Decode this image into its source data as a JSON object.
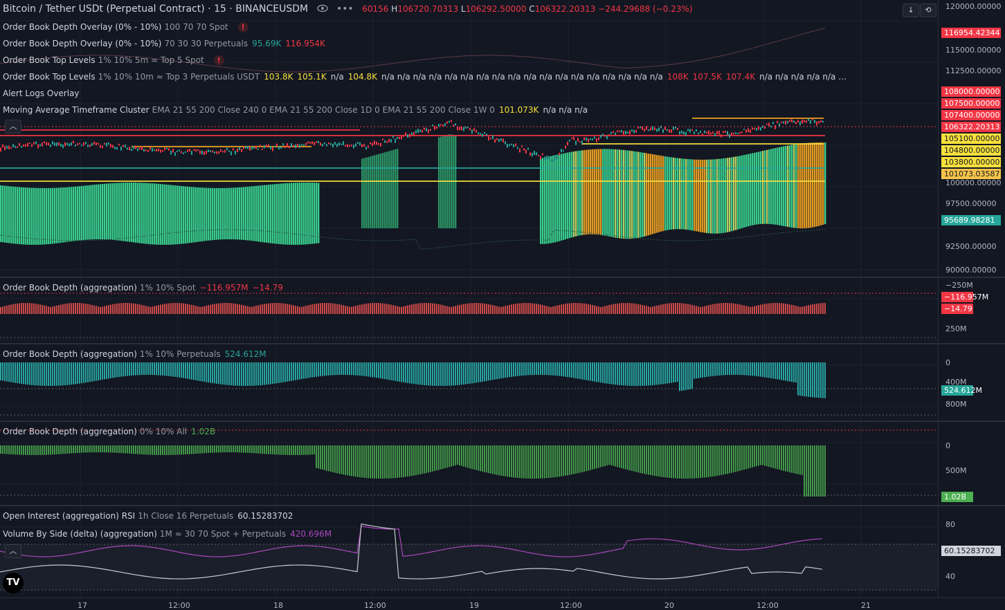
{
  "header": {
    "symbol": "Bitcoin / Tether USDt (Perpetual Contract)",
    "interval": "15",
    "exchange": "BINANCEUSDM",
    "ohlc_open": "60156",
    "ohlc_high_label": "H",
    "ohlc_high": "106720.70313",
    "ohlc_low_label": "L",
    "ohlc_low": "106292.50000",
    "ohlc_close_label": "C",
    "ohlc_close": "106322.20313",
    "change": "−244.29688 (−0.23%)"
  },
  "main_legends": [
    {
      "title": "Order Book Depth Overlay (0% - 10%)",
      "params": "100 70 70 Spot",
      "values": [],
      "warn": true
    },
    {
      "title": "Order Book Depth Overlay (0% - 10%)",
      "params": "70 30 30 Perpetuals",
      "values": [
        {
          "t": "95.69K",
          "c": "#26a69a"
        },
        {
          "t": "116.954K",
          "c": "#f23645"
        }
      ],
      "warn": false
    },
    {
      "title": "Order Book Top Levels",
      "params": "1% 10% 5m ≈ Top 5 Spot",
      "values": [],
      "warn": true
    },
    {
      "title": "Order Book Top Levels",
      "params": "1% 10% 10m ≈ Top 3 Perpetuals USDT",
      "values": [
        {
          "t": "103.8K",
          "c": "#f7e03c"
        },
        {
          "t": "105.1K",
          "c": "#f7e03c"
        },
        {
          "t": "n/a",
          "c": "#d1d4dc"
        },
        {
          "t": "104.8K",
          "c": "#f7e03c"
        },
        {
          "t": "n/a n/a n/a n/a n/a n/a n/a n/a n/a n/a n/a n/a n/a n/a n/a n/a n/a n/a",
          "c": "#d1d4dc"
        },
        {
          "t": "108K",
          "c": "#f23645"
        },
        {
          "t": "107.5K",
          "c": "#f23645"
        },
        {
          "t": "107.4K",
          "c": "#f23645"
        },
        {
          "t": "n/a n/a n/a n/a n/a …",
          "c": "#d1d4dc"
        }
      ],
      "warn": false
    },
    {
      "title": "Alert Logs Overlay",
      "params": "",
      "values": [],
      "warn": false
    },
    {
      "title": "Moving Average Timeframe Cluster",
      "params": "EMA 21 55 200 Close 240 0 EMA 21 55 200 Close 1D 0 EMA 21 55 200 Close 1W 0",
      "values": [
        {
          "t": "101.073K",
          "c": "#f7e03c"
        },
        {
          "t": "n/a n/a n/a",
          "c": "#d1d4dc"
        }
      ],
      "warn": false
    }
  ],
  "warn_glyph": "!",
  "price_scale": {
    "ticks": [
      "120000.00000",
      "115000.00000",
      "112500.00000",
      "100000.00000",
      "97500.00000",
      "92500.00000",
      "90000.00000"
    ],
    "labels": [
      {
        "t": "116954.42344",
        "bg": "#f23645",
        "fg": "#ffffff"
      },
      {
        "t": "108000.00000",
        "bg": "#f23645",
        "fg": "#ffffff"
      },
      {
        "t": "107500.00000",
        "bg": "#f23645",
        "fg": "#ffffff"
      },
      {
        "t": "107400.00000",
        "bg": "#f23645",
        "fg": "#ffffff"
      },
      {
        "t": "106322.20313",
        "bg": "#f23645",
        "fg": "#ffffff"
      },
      {
        "t": "105100.00000",
        "bg": "#f7e03c",
        "fg": "#131722"
      },
      {
        "t": "104800.00000",
        "bg": "#f7e03c",
        "fg": "#131722"
      },
      {
        "t": "103800.00000",
        "bg": "#f7e03c",
        "fg": "#131722"
      },
      {
        "t": "101073.03587",
        "bg": "#f7c44a",
        "fg": "#131722"
      },
      {
        "t": "95689.98281",
        "bg": "#26a69a",
        "fg": "#ffffff"
      }
    ]
  },
  "panes": [
    {
      "title": "Order Book Depth (aggregation)",
      "params": "1% 10% Spot",
      "values": [
        {
          "t": "−116.957M",
          "c": "#f23645"
        },
        {
          "t": "−14.79",
          "c": "#f23645"
        }
      ],
      "ticks": [
        "−250M",
        "250M"
      ],
      "labels": [
        {
          "t": "−116.957M",
          "bg": "#f23645"
        },
        {
          "t": "−14.79",
          "bg": "#f23645"
        }
      ]
    },
    {
      "title": "Order Book Depth (aggregation)",
      "params": "1% 10% Perpetuals",
      "values": [
        {
          "t": "524.612M",
          "c": "#26a69a"
        }
      ],
      "ticks": [
        "0",
        "400M",
        "800M"
      ],
      "labels": [
        {
          "t": "524.612M",
          "bg": "#26a69a"
        }
      ]
    },
    {
      "title": "Order Book Depth (aggregation)",
      "params": "0% 10% All",
      "values": [
        {
          "t": "1.02B",
          "c": "#4caf50"
        }
      ],
      "ticks": [
        "0",
        "500M"
      ],
      "labels": [
        {
          "t": "1.02B",
          "bg": "#4caf50"
        }
      ]
    },
    {
      "title": "Open Interest (aggregation) RSI",
      "params": "1h Close 16 Perpetuals",
      "values": [
        {
          "t": "60.15283702",
          "c": "#d1d4dc"
        }
      ],
      "title2": "Volume By Side (delta) (aggregation)",
      "params2": "1M ≈ 30 70 Spot + Perpetuals",
      "values2": [
        {
          "t": "420.696M",
          "c": "#ab47bc"
        }
      ],
      "ticks": [
        "80",
        "40"
      ],
      "labels": [
        {
          "t": "60.15283702",
          "bg": "#d1d4dc",
          "fg": "#131722"
        }
      ]
    }
  ],
  "time_axis": [
    "17",
    "12:00",
    "18",
    "12:00",
    "19",
    "12:00",
    "20",
    "12:00",
    "21"
  ],
  "icons": {
    "eye": "eye-icon",
    "more": "more-icon",
    "collapse": "chevron-up-icon",
    "scroll": "arrow-down-icon",
    "reset": "reset-icon",
    "logo": "tradingview-logo"
  },
  "logo_text": "TV"
}
